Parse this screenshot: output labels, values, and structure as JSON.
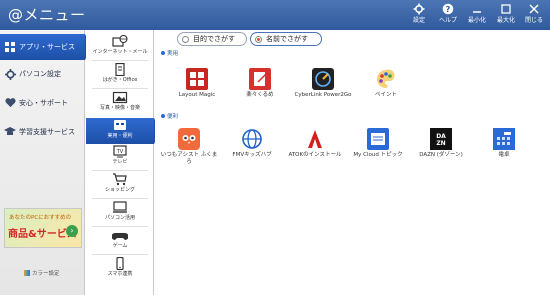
{
  "window": {
    "title": "@メニュー",
    "buttons": [
      {
        "label": "設定",
        "icon": "gear-icon"
      },
      {
        "label": "ヘルプ",
        "icon": "help-icon"
      },
      {
        "label": "最小化",
        "icon": "minimize-icon"
      },
      {
        "label": "最大化",
        "icon": "maximize-icon"
      },
      {
        "label": "閉じる",
        "icon": "close-icon"
      }
    ]
  },
  "sidebar": {
    "items": [
      {
        "label": "アプリ・サービス",
        "icon": "apps-icon",
        "active": true
      },
      {
        "label": "パソコン設定",
        "icon": "gear-icon",
        "active": false
      },
      {
        "label": "安心・サポート",
        "icon": "heart-icon",
        "active": false
      },
      {
        "label": "学習支援サービス",
        "icon": "graduation-icon",
        "active": false
      }
    ],
    "banner": {
      "line1": "あなたのPCにおすすめの",
      "line2": "商品&サービス",
      "arrow": "›"
    },
    "color_setting": "カラー設定"
  },
  "categories": [
    {
      "label": "インターネット・メール",
      "icon": "internet-mail-icon",
      "active": false
    },
    {
      "label": "はがき・Office",
      "icon": "postcard-icon",
      "active": false
    },
    {
      "label": "写真・映像・音楽",
      "icon": "photo-icon",
      "active": false
    },
    {
      "label": "実用・便利",
      "icon": "utility-icon",
      "active": true
    },
    {
      "label": "テレビ",
      "icon": "tv-icon",
      "active": false
    },
    {
      "label": "ショッピング",
      "icon": "cart-icon",
      "active": false
    },
    {
      "label": "パソコン活用",
      "icon": "pc-icon",
      "active": false
    },
    {
      "label": "ゲーム",
      "icon": "gamepad-icon",
      "active": false
    },
    {
      "label": "スマホ連携",
      "icon": "smartphone-icon",
      "active": false
    }
  ],
  "search": {
    "by_purpose": "目的でさがす",
    "by_name": "名前でさがす",
    "selected": "by_name"
  },
  "sections": [
    {
      "title": "実用",
      "apps": [
        {
          "label": "Layout Magic",
          "icon": "layout-magic-icon"
        },
        {
          "label": "楽々くるめ",
          "icon": "rakuraku-icon"
        },
        {
          "label": "CyberLink Power2Go",
          "icon": "power2go-icon"
        },
        {
          "label": "ペイント",
          "icon": "paint-icon"
        }
      ]
    },
    {
      "title": "便利",
      "apps": [
        {
          "label": "いつもアシスト ふくまろ",
          "icon": "fukumaro-icon"
        },
        {
          "label": "FMVキッズハブ",
          "icon": "globe-icon"
        },
        {
          "label": "ATOKのインストール",
          "icon": "atok-icon"
        },
        {
          "label": "My Cloud トピック",
          "icon": "mycloud-icon"
        },
        {
          "label": "DAZN (ダゾーン)",
          "icon": "dazn-icon"
        },
        {
          "label": "電卓",
          "icon": "calculator-icon"
        }
      ]
    }
  ],
  "colors": {
    "titlebar": "#2f5a9e",
    "active_nav": "#1d4fa6",
    "section_label": "#2a57a8",
    "radio_selected": "#e0531f"
  }
}
